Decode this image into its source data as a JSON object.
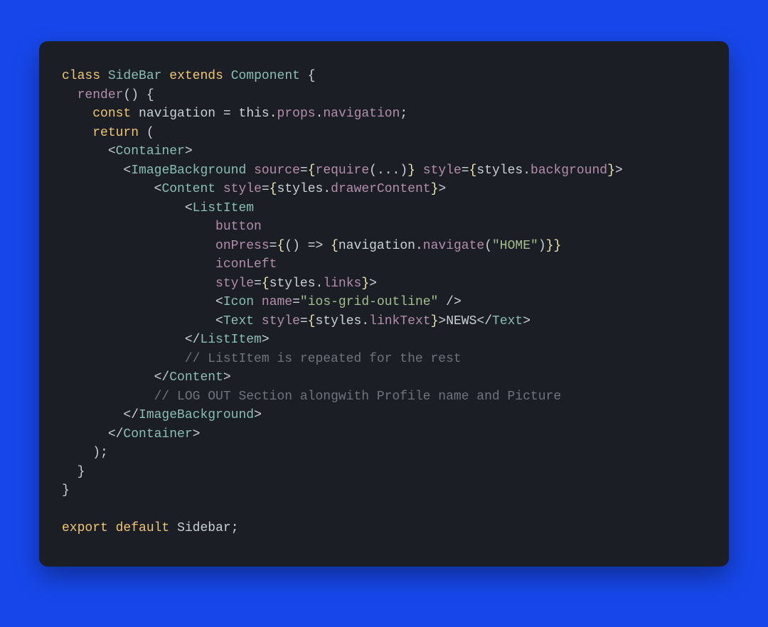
{
  "code": {
    "l01": {
      "kw_class": "class",
      "name": "SideBar",
      "kw_ext": "extends",
      "comp": "Component",
      "brace": "{"
    },
    "l02": {
      "fn": "render",
      "parens": "()",
      "brace": "{"
    },
    "l03": {
      "kw_const": "const",
      "var": "navigation",
      "eq": "=",
      "this": "this",
      "dot1": ".",
      "props": "props",
      "dot2": ".",
      "nav": "navigation",
      "semi": ";"
    },
    "l04": {
      "kw_return": "return",
      "paren": "("
    },
    "l05": {
      "open": "<",
      "tag": "Container",
      "close": ">"
    },
    "l06": {
      "open": "<",
      "tag": "ImageBackground",
      "a1": "source",
      "eq1": "=",
      "lb1": "{",
      "req": "require",
      "args": "(...)",
      "rb1": "}",
      "a2": "style",
      "eq2": "=",
      "lb2": "{",
      "styles": "styles",
      "dot": ".",
      "field": "background",
      "rb2": "}",
      "close": ">"
    },
    "l07": {
      "open": "<",
      "tag": "Content",
      "a1": "style",
      "eq": "=",
      "lb": "{",
      "styles": "styles",
      "dot": ".",
      "field": "drawerContent",
      "rb": "}",
      "close": ">"
    },
    "l08": {
      "open": "<",
      "tag": "ListItem"
    },
    "l09": {
      "attr": "button"
    },
    "l10": {
      "attr": "onPress",
      "eq": "=",
      "lb": "{",
      "arrow": "() => ",
      "lb2": "{",
      "nav": "navigation",
      "dot": ".",
      "fn": "navigate",
      "lp": "(",
      "str": "\"HOME\"",
      "rp": ")",
      "rb2": "}",
      "rb": "}"
    },
    "l11": {
      "attr": "iconLeft"
    },
    "l12": {
      "attr": "style",
      "eq": "=",
      "lb": "{",
      "styles": "styles",
      "dot": ".",
      "field": "links",
      "rb": "}",
      "close": ">"
    },
    "l13": {
      "open": "<",
      "tag": "Icon",
      "attr": "name",
      "eq": "=",
      "str": "\"ios-grid-outline\"",
      "close": " />"
    },
    "l14": {
      "open": "<",
      "tag": "Text",
      "attr": "style",
      "eq": "=",
      "lb": "{",
      "styles": "styles",
      "dot": ".",
      "field": "linkText",
      "rb": "}",
      "close": ">",
      "text": "NEWS",
      "open2": "</",
      "tag2": "Text",
      "close2": ">"
    },
    "l15": {
      "open": "</",
      "tag": "ListItem",
      "close": ">"
    },
    "l16": {
      "comment": "// ListItem is repeated for the rest"
    },
    "l17": {
      "open": "</",
      "tag": "Content",
      "close": ">"
    },
    "l18": {
      "comment": "// LOG OUT Section alongwith Profile name and Picture"
    },
    "l19": {
      "open": "</",
      "tag": "ImageBackground",
      "close": ">"
    },
    "l20": {
      "open": "</",
      "tag": "Container",
      "close": ">"
    },
    "l21": {
      "paren": ");"
    },
    "l22": {
      "brace": "}"
    },
    "l23": {
      "brace": "}"
    },
    "l24": {
      "kw_export": "export",
      "kw_default": "default",
      "name": "Sidebar",
      "semi": ";"
    }
  }
}
